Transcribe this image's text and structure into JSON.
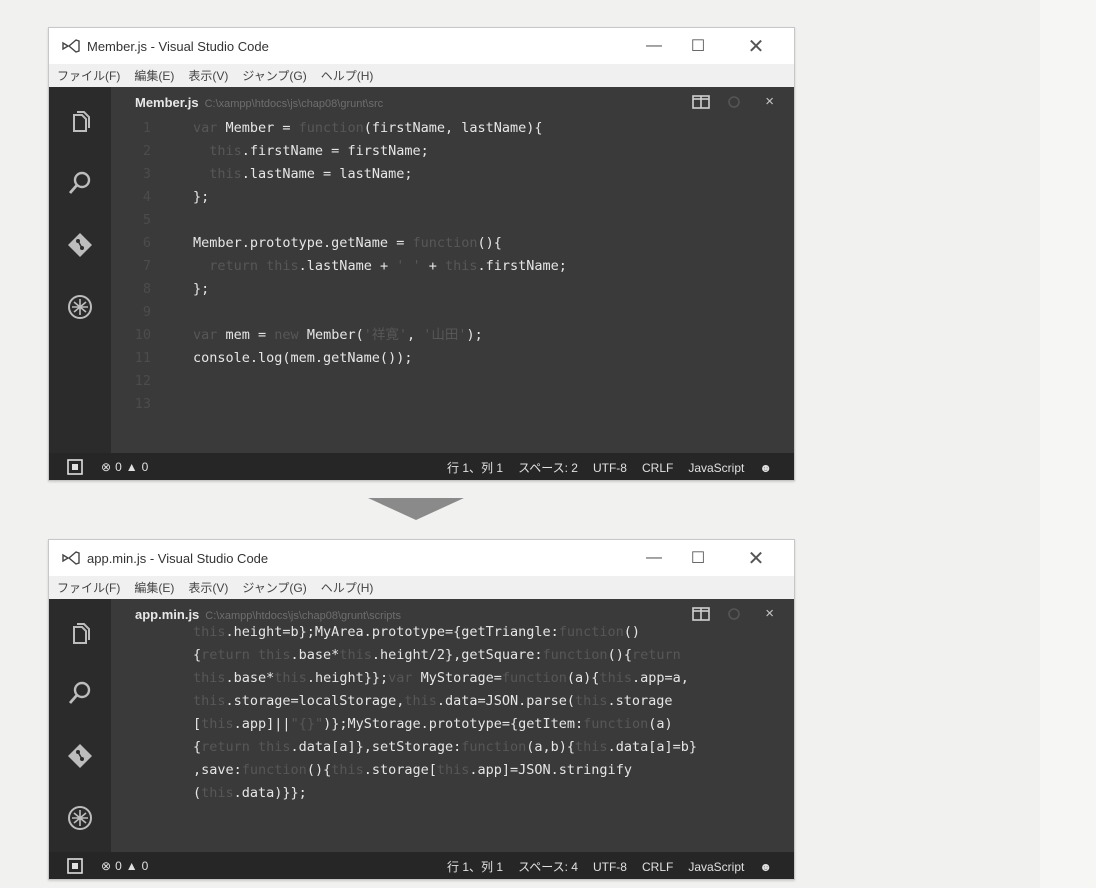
{
  "window1": {
    "title": "Member.js - Visual Studio Code",
    "controls": {
      "minimize": "—",
      "maximize": "☐",
      "close": "✕"
    },
    "menu": [
      "ファイル(F)",
      "編集(E)",
      "表示(V)",
      "ジャンプ(G)",
      "ヘルプ(H)"
    ],
    "tab": {
      "file": "Member.js",
      "path": "C:\\xampp\\htdocs\\js\\chap08\\grunt\\src",
      "close": "×"
    },
    "code_lines": [
      {
        "n": "1",
        "segs": [
          {
            "t": "var ",
            "k": 1
          },
          {
            "t": "Member = "
          },
          {
            "t": "function",
            "k": 1
          },
          {
            "t": "(firstName, lastName){"
          }
        ]
      },
      {
        "n": "2",
        "segs": [
          {
            "t": "  "
          },
          {
            "t": "this",
            "k": 1
          },
          {
            "t": ".firstName = firstName;"
          }
        ]
      },
      {
        "n": "3",
        "segs": [
          {
            "t": "  "
          },
          {
            "t": "this",
            "k": 1
          },
          {
            "t": ".lastName = lastName;"
          }
        ]
      },
      {
        "n": "4",
        "segs": [
          {
            "t": "};"
          }
        ]
      },
      {
        "n": "5",
        "segs": []
      },
      {
        "n": "6",
        "segs": [
          {
            "t": "Member.prototype.getName = "
          },
          {
            "t": "function",
            "k": 1
          },
          {
            "t": "(){"
          }
        ]
      },
      {
        "n": "7",
        "segs": [
          {
            "t": "  "
          },
          {
            "t": "return this",
            "k": 1
          },
          {
            "t": ".lastName + "
          },
          {
            "t": "' '",
            "k": 1
          },
          {
            "t": " + "
          },
          {
            "t": "this",
            "k": 1
          },
          {
            "t": ".firstName;"
          }
        ]
      },
      {
        "n": "8",
        "segs": [
          {
            "t": "};"
          }
        ]
      },
      {
        "n": "9",
        "segs": []
      },
      {
        "n": "10",
        "segs": [
          {
            "t": "var ",
            "k": 1
          },
          {
            "t": "mem = "
          },
          {
            "t": "new ",
            "k": 1
          },
          {
            "t": "Member("
          },
          {
            "t": "'祥寛'",
            "k": 1
          },
          {
            "t": ", "
          },
          {
            "t": "'山田'",
            "k": 1
          },
          {
            "t": ");"
          }
        ]
      },
      {
        "n": "11",
        "segs": [
          {
            "t": "console.log(mem.getName());"
          }
        ]
      },
      {
        "n": "12",
        "segs": []
      },
      {
        "n": "13",
        "segs": []
      }
    ],
    "status": {
      "errors": "0",
      "warnings": "0",
      "position": "行 1、列 1",
      "spaces": "スペース: 2",
      "encoding": "UTF-8",
      "eol": "CRLF",
      "language": "JavaScript"
    }
  },
  "window2": {
    "title": "app.min.js - Visual Studio Code",
    "controls": {
      "minimize": "—",
      "maximize": "☐",
      "close": "✕"
    },
    "menu": [
      "ファイル(F)",
      "編集(E)",
      "表示(V)",
      "ジャンプ(G)",
      "ヘルプ(H)"
    ],
    "tab": {
      "file": "app.min.js",
      "path": "C:\\xampp\\htdocs\\js\\chap08\\grunt\\scripts",
      "close": "×"
    },
    "code_lines": [
      {
        "segs": [
          {
            "t": "this",
            "k": 1
          },
          {
            "t": ".height=b};MyArea.prototype={getTriangle:"
          },
          {
            "t": "function",
            "k": 1
          },
          {
            "t": "()"
          }
        ]
      },
      {
        "segs": [
          {
            "t": "{"
          },
          {
            "t": "return this",
            "k": 1
          },
          {
            "t": ".base*"
          },
          {
            "t": "this",
            "k": 1
          },
          {
            "t": ".height/2},getSquare:"
          },
          {
            "t": "function",
            "k": 1
          },
          {
            "t": "(){"
          },
          {
            "t": "return",
            "k": 1
          }
        ]
      },
      {
        "segs": [
          {
            "t": "this",
            "k": 1
          },
          {
            "t": ".base*"
          },
          {
            "t": "this",
            "k": 1
          },
          {
            "t": ".height}};"
          },
          {
            "t": "var ",
            "k": 1
          },
          {
            "t": "MyStorage="
          },
          {
            "t": "function",
            "k": 1
          },
          {
            "t": "(a){"
          },
          {
            "t": "this",
            "k": 1
          },
          {
            "t": ".app=a,"
          }
        ]
      },
      {
        "segs": [
          {
            "t": "this",
            "k": 1
          },
          {
            "t": ".storage=localStorage,"
          },
          {
            "t": "this",
            "k": 1
          },
          {
            "t": ".data=JSON.parse("
          },
          {
            "t": "this",
            "k": 1
          },
          {
            "t": ".storage"
          }
        ]
      },
      {
        "segs": [
          {
            "t": "["
          },
          {
            "t": "this",
            "k": 1
          },
          {
            "t": ".app]||"
          },
          {
            "t": "\"{}\"",
            "k": 1
          },
          {
            "t": ")};MyStorage.prototype={getItem:"
          },
          {
            "t": "function",
            "k": 1
          },
          {
            "t": "(a)"
          }
        ]
      },
      {
        "segs": [
          {
            "t": "{"
          },
          {
            "t": "return this",
            "k": 1
          },
          {
            "t": ".data[a]},setStorage:"
          },
          {
            "t": "function",
            "k": 1
          },
          {
            "t": "(a,b){"
          },
          {
            "t": "this",
            "k": 1
          },
          {
            "t": ".data[a]=b}"
          }
        ]
      },
      {
        "segs": [
          {
            "t": ",save:"
          },
          {
            "t": "function",
            "k": 1
          },
          {
            "t": "(){"
          },
          {
            "t": "this",
            "k": 1
          },
          {
            "t": ".storage["
          },
          {
            "t": "this",
            "k": 1
          },
          {
            "t": ".app]=JSON.stringify"
          }
        ]
      },
      {
        "segs": [
          {
            "t": "("
          },
          {
            "t": "this",
            "k": 1
          },
          {
            "t": ".data)}};"
          }
        ]
      }
    ],
    "status": {
      "errors": "0",
      "warnings": "0",
      "position": "行 1、列 1",
      "spaces": "スペース: 4",
      "encoding": "UTF-8",
      "eol": "CRLF",
      "language": "JavaScript"
    }
  },
  "colors": {
    "editor_bg": "#3a3a3a",
    "activity_bar": "#2b2b2b",
    "status_bar": "#262626",
    "keyword": "#575757",
    "text": "#e6e6e6"
  },
  "icons": [
    "vscode-logo-icon",
    "explorer-icon",
    "search-icon",
    "git-icon",
    "debug-icon",
    "split-editor-icon",
    "status-sync-icon",
    "error-icon",
    "warning-icon",
    "smiley-icon",
    "down-arrow-icon"
  ]
}
